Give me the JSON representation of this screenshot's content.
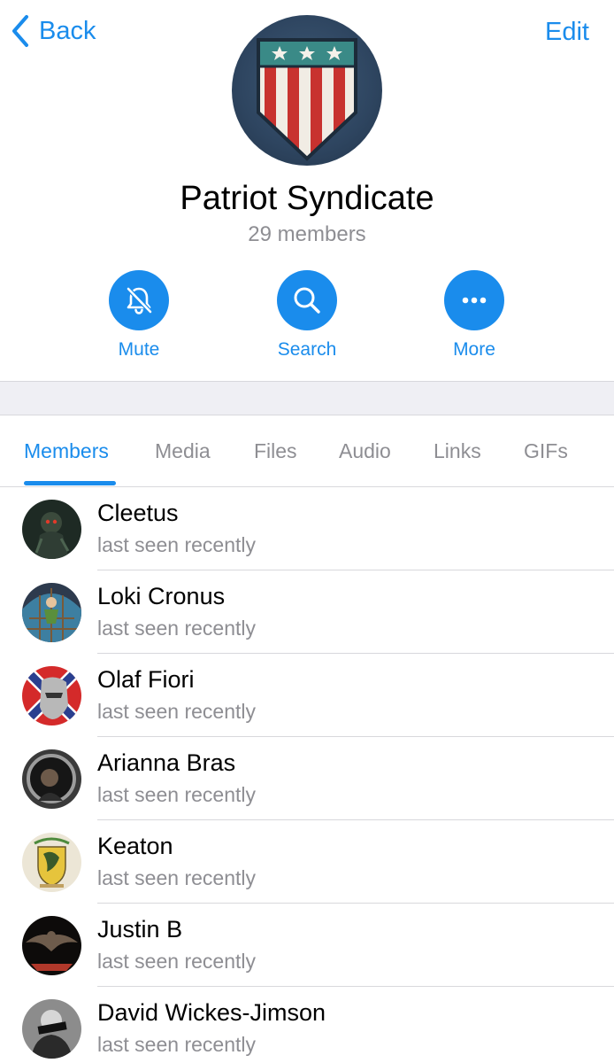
{
  "nav": {
    "back_label": "Back",
    "edit_label": "Edit"
  },
  "group": {
    "title": "Patriot Syndicate",
    "subtitle": "29 members",
    "avatar_icon": "shield-flag-icon"
  },
  "actions": [
    {
      "label": "Mute",
      "icon": "bell-slash-icon"
    },
    {
      "label": "Search",
      "icon": "search-icon"
    },
    {
      "label": "More",
      "icon": "ellipsis-icon"
    }
  ],
  "tabs": [
    {
      "label": "Members",
      "active": true
    },
    {
      "label": "Media"
    },
    {
      "label": "Files"
    },
    {
      "label": "Audio"
    },
    {
      "label": "Links"
    },
    {
      "label": "GIFs"
    }
  ],
  "members": [
    {
      "first": "Cleetus",
      "last": "",
      "status": "last seen recently"
    },
    {
      "first": "Loki",
      "last": "Cronus",
      "status": "last seen recently"
    },
    {
      "first": "Olaf",
      "last": "Fiori",
      "status": "last seen recently"
    },
    {
      "first": "Arianna",
      "last": "Bras",
      "status": "last seen recently"
    },
    {
      "first": "Keaton",
      "last": "",
      "status": "last seen recently"
    },
    {
      "first": "Justin",
      "last": "B",
      "status": "last seen recently"
    },
    {
      "first": "David",
      "last": "Wickes-Jimson",
      "status": "last seen recently"
    }
  ],
  "colors": {
    "accent": "#1a8cec",
    "secondary_text": "#8e8e93",
    "separator_bg": "#efeff4"
  }
}
